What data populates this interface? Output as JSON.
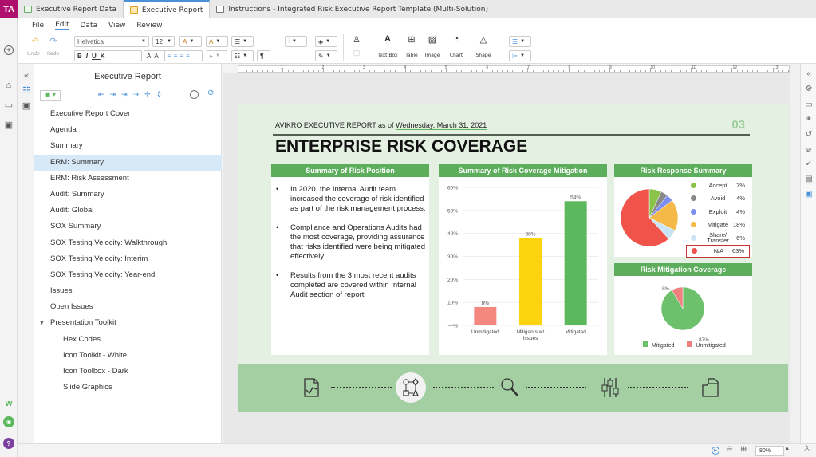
{
  "user": {
    "initials": "TA"
  },
  "tabs": [
    {
      "label": "Executive Report Data",
      "icon": "spreadsheet-icon",
      "active": false
    },
    {
      "label": "Executive Report",
      "icon": "report-icon",
      "active": true
    },
    {
      "label": "Instructions - Integrated Risk Executive Report Template (Multi-Solution)",
      "icon": "document-icon",
      "active": false
    }
  ],
  "menu": [
    "File",
    "Edit",
    "Data",
    "View",
    "Review"
  ],
  "toolbar": {
    "undo_label": "Undo",
    "redo_label": "Redo",
    "font_family": "Helvetica",
    "font_size": "12",
    "text_box_label": "Text Box",
    "table_label": "Table",
    "image_label": "Image",
    "chart_label": "Chart",
    "shape_label": "Shape"
  },
  "ruler": [
    "1",
    "2",
    "3",
    "4",
    "5",
    "6",
    "7",
    "8",
    "9",
    "10",
    "11",
    "12",
    "13"
  ],
  "outline": {
    "title": "Executive Report",
    "items": [
      {
        "label": "Executive Report Cover"
      },
      {
        "label": "Agenda"
      },
      {
        "label": "Summary"
      },
      {
        "label": "ERM: Summary",
        "selected": true
      },
      {
        "label": "ERM: Risk Assessment"
      },
      {
        "label": "Audit: Summary"
      },
      {
        "label": "Audit: Global"
      },
      {
        "label": "SOX Summary"
      },
      {
        "label": "SOX Testing Velocity: Walkthrough"
      },
      {
        "label": "SOX Testing Velocity: Interim"
      },
      {
        "label": "SOX Testing Velocity: Year-end"
      },
      {
        "label": "Issues"
      },
      {
        "label": "Open Issues"
      },
      {
        "label": "Presentation Toolkit",
        "expanded": true
      },
      {
        "label": "Hex Codes",
        "child": true
      },
      {
        "label": "Icon Toolkit - White",
        "child": true
      },
      {
        "label": "Icon Toolbox - Dark",
        "child": true
      },
      {
        "label": "Slide Graphics",
        "child": true
      }
    ]
  },
  "slide": {
    "header_prefix": "AVIKRO EXECUTIVE REPORT as of",
    "header_date": "Wednesday, March 31, 2021",
    "number": "03",
    "title": "ENTERPRISE RISK COVERAGE",
    "risk_position": {
      "heading": "Summary of Risk Position",
      "bullets": [
        "In 2020, the Internal Audit team increased the coverage of risk identified as part of the risk management process.",
        "Compliance and Operations Audits had the most coverage, providing assurance that risks identified were being mitigated effectively",
        "Results from the 3 most recent audits completed are covered within Internal Audit section of report"
      ]
    },
    "coverage_mitigation_heading": "Summary of Risk Coverage Mitigation",
    "risk_response": {
      "heading": "Risk Response Summary",
      "legend": [
        {
          "label": "Accept",
          "pct": "7%",
          "color": "#8bc34a"
        },
        {
          "label": "Avoid",
          "pct": "4%",
          "color": "#888888"
        },
        {
          "label": "Exploit",
          "pct": "4%",
          "color": "#7b8ff0"
        },
        {
          "label": "Mitigate",
          "pct": "18%",
          "color": "#f5b94a"
        },
        {
          "label": "Share/ Transfer",
          "pct": "6%",
          "color": "#c8e4f5"
        },
        {
          "label": "N/A",
          "pct": "63%",
          "color": "#f0534a"
        }
      ]
    },
    "mitigation_coverage": {
      "heading": "Risk Mitigation Coverage",
      "legend": [
        "Mitigated",
        "Unmitigated"
      ]
    }
  },
  "chart_data": [
    {
      "type": "bar",
      "title": "Summary of Risk Coverage Mitigation",
      "categories": [
        "Unmitigated",
        "Mitigants w/ Issues",
        "Mitigated"
      ],
      "values": [
        8,
        38,
        54
      ],
      "data_labels": [
        "8%",
        "38%",
        "54%"
      ],
      "colors": [
        "#f4877f",
        "#fbd40f",
        "#5cb85c"
      ],
      "yticks": [
        "—%",
        "10%",
        "20%",
        "30%",
        "40%",
        "50%",
        "60%"
      ],
      "ylim": [
        0,
        60
      ],
      "xlabel": "",
      "ylabel": "",
      "grid": true
    },
    {
      "type": "pie",
      "title": "Risk Response Summary",
      "categories": [
        "Accept",
        "Avoid",
        "Exploit",
        "Mitigate",
        "Share/Transfer",
        "N/A"
      ],
      "values": [
        7,
        4,
        4,
        18,
        6,
        63
      ],
      "colors": [
        "#8bc34a",
        "#888888",
        "#7b8ff0",
        "#f5b94a",
        "#c8e4f5",
        "#f0534a"
      ],
      "legend": "right"
    },
    {
      "type": "pie",
      "title": "Risk Mitigation Coverage",
      "categories": [
        "Mitigated",
        "Unmitigated"
      ],
      "values": [
        87,
        8
      ],
      "data_labels": [
        "87%",
        "8%"
      ],
      "colors": [
        "#6dc16d",
        "#f08080"
      ],
      "legend": "bottom"
    }
  ],
  "status": {
    "zoom": "80%"
  }
}
